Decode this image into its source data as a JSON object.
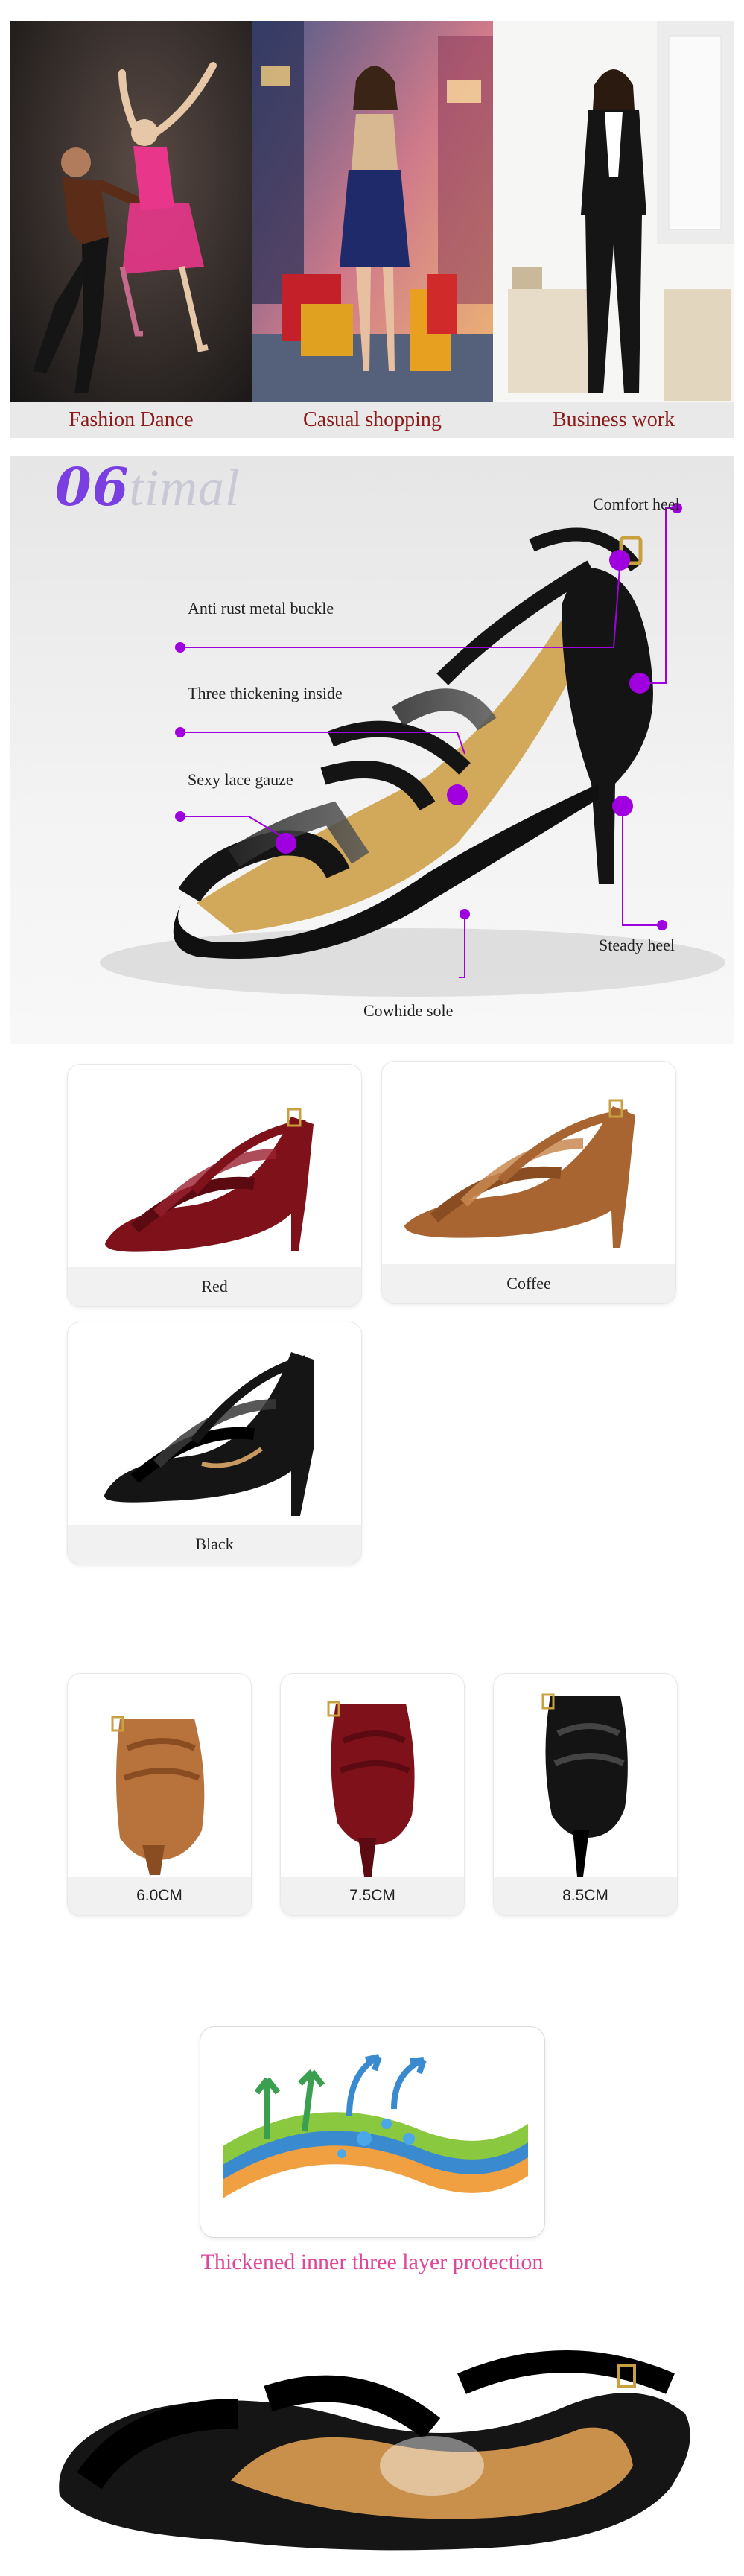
{
  "scenes": [
    {
      "label": "Fashion Dance"
    },
    {
      "label": "Casual shopping"
    },
    {
      "label": "Business work"
    }
  ],
  "logo": {
    "number": "06",
    "text": "timal"
  },
  "features": {
    "comfort_heel": "Comfort heel",
    "buckle": "Anti rust metal buckle",
    "thickening": "Three thickening inside",
    "lace": "Sexy lace gauze",
    "steady_heel": "Steady heel",
    "sole": "Cowhide sole"
  },
  "colors": [
    {
      "name": "Red",
      "hex": "#7e1119"
    },
    {
      "name": "Coffee",
      "hex": "#a86532"
    },
    {
      "name": "Black",
      "hex": "#151515"
    }
  ],
  "heels": [
    {
      "height": "6.0CM",
      "hex": "#b8733d"
    },
    {
      "height": "7.5CM",
      "hex": "#7e1119"
    },
    {
      "height": "8.5CM",
      "hex": "#141414"
    }
  ],
  "protection": {
    "caption": "Thickened inner three layer protection"
  },
  "accent_color": "#a000e0"
}
